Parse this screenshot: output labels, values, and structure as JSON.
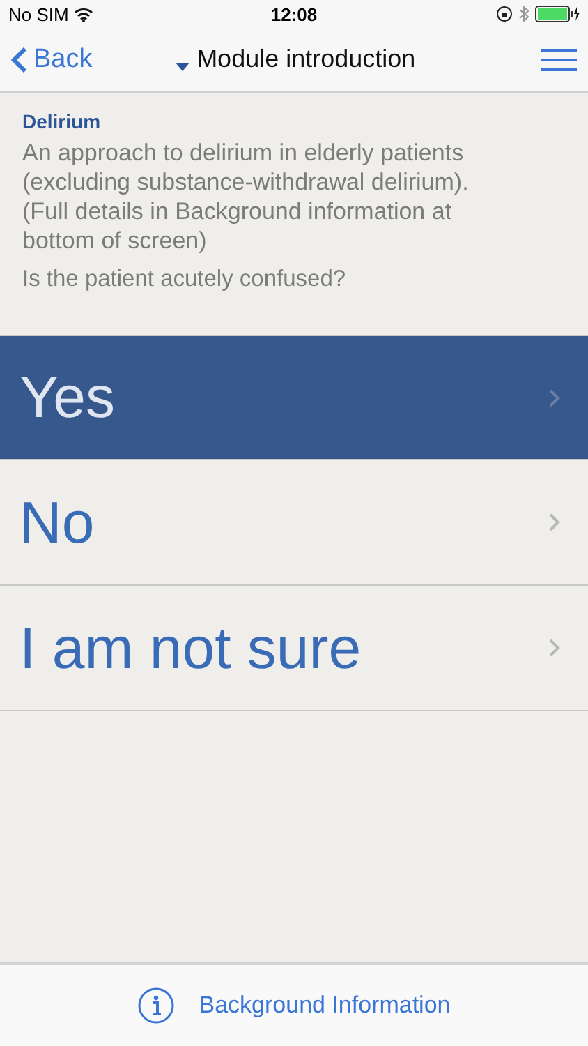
{
  "status_bar": {
    "carrier": "No SIM",
    "time": "12:08"
  },
  "nav_bar": {
    "back": "Back",
    "title": "Module introduction"
  },
  "module": {
    "title": "Delirium",
    "description": "An approach to delirium in elderly patients (excluding substance-withdrawal delirium). (Full details in Background information at bottom of screen)",
    "question": "Is the patient acutely confused?"
  },
  "answers": [
    {
      "label": "Yes",
      "selected": true
    },
    {
      "label": "No",
      "selected": false
    },
    {
      "label": "I am not sure",
      "selected": false
    }
  ],
  "footer": {
    "label": "Background Information"
  }
}
